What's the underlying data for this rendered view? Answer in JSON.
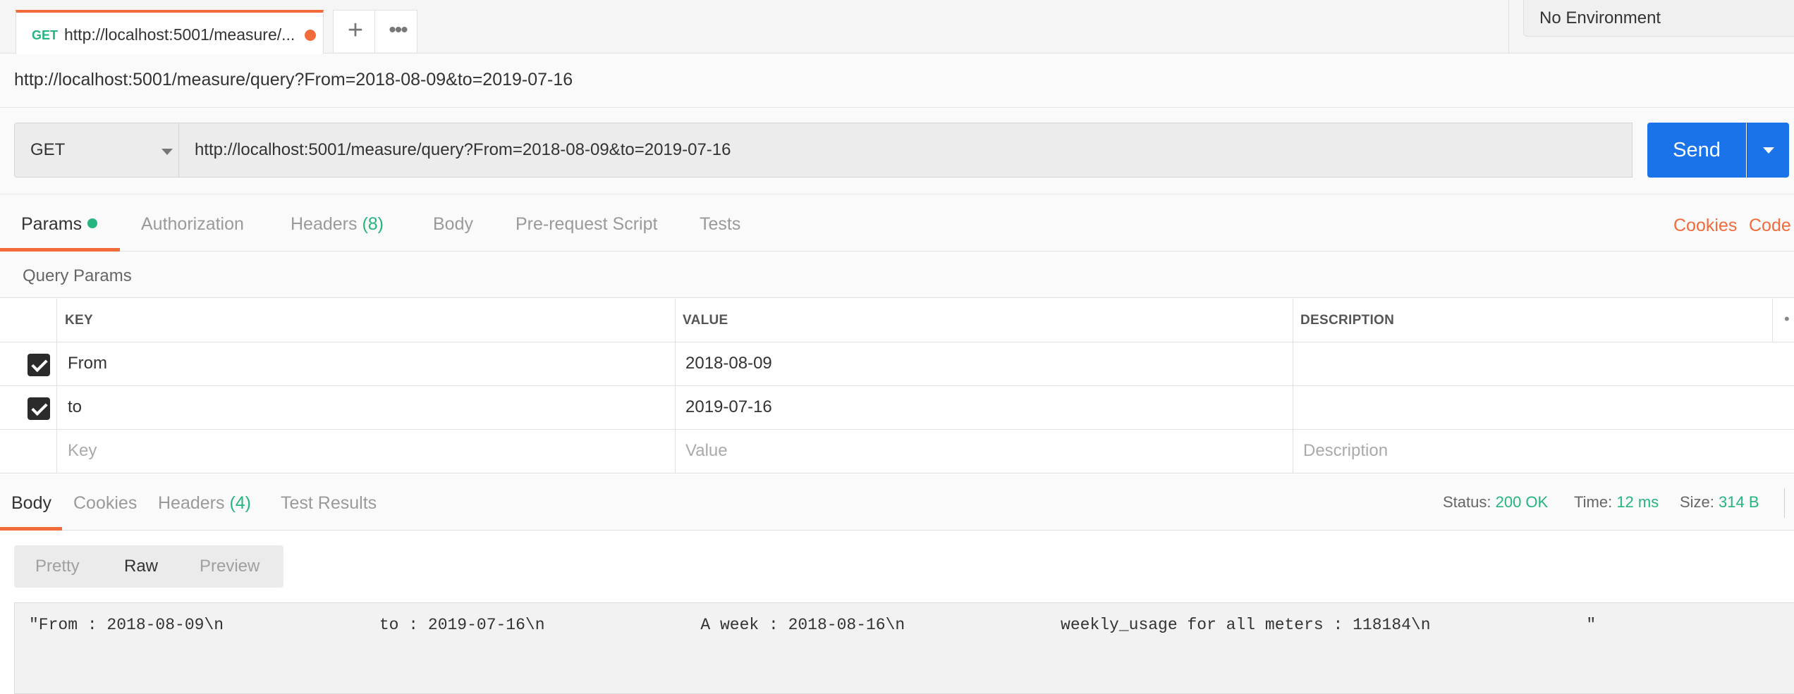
{
  "tab": {
    "method": "GET",
    "title": "http://localhost:5001/measure/...",
    "unsaved_color": "#f26b3a"
  },
  "environment": {
    "label": "No Environment"
  },
  "request_name": "http://localhost:5001/measure/query?From=2018-08-09&to=2019-07-16",
  "request": {
    "method": "GET",
    "url": "http://localhost:5001/measure/query?From=2018-08-09&to=2019-07-16",
    "send_label": "Send"
  },
  "request_tabs": {
    "params": "Params",
    "authorization": "Authorization",
    "headers": "Headers",
    "headers_count": "(8)",
    "body": "Body",
    "prerequest": "Pre-request Script",
    "tests": "Tests",
    "cookies_link": "Cookies",
    "code_link": "Code"
  },
  "query_params": {
    "title": "Query Params",
    "columns": {
      "key": "KEY",
      "value": "VALUE",
      "description": "DESCRIPTION"
    },
    "rows": [
      {
        "checked": true,
        "key": "From",
        "value": "2018-08-09",
        "description": ""
      },
      {
        "checked": true,
        "key": "to",
        "value": "2019-07-16",
        "description": ""
      }
    ],
    "placeholders": {
      "key": "Key",
      "value": "Value",
      "description": "Description"
    }
  },
  "response_tabs": {
    "body": "Body",
    "cookies": "Cookies",
    "headers": "Headers",
    "headers_count": "(4)",
    "test_results": "Test Results"
  },
  "status": {
    "status_label": "Status:",
    "status_value": "200 OK",
    "time_label": "Time:",
    "time_value": "12 ms",
    "size_label": "Size:",
    "size_value": "314 B"
  },
  "view_modes": {
    "pretty": "Pretty",
    "raw": "Raw",
    "preview": "Preview",
    "selected": "Raw"
  },
  "response_body": "\"From : 2018-08-09\\n                to : 2019-07-16\\n                A week : 2018-08-16\\n                weekly_usage for all meters : 118184\\n                \"",
  "colors": {
    "accent": "#f26b3a",
    "success": "#26b47f",
    "send": "#1a73e8"
  }
}
